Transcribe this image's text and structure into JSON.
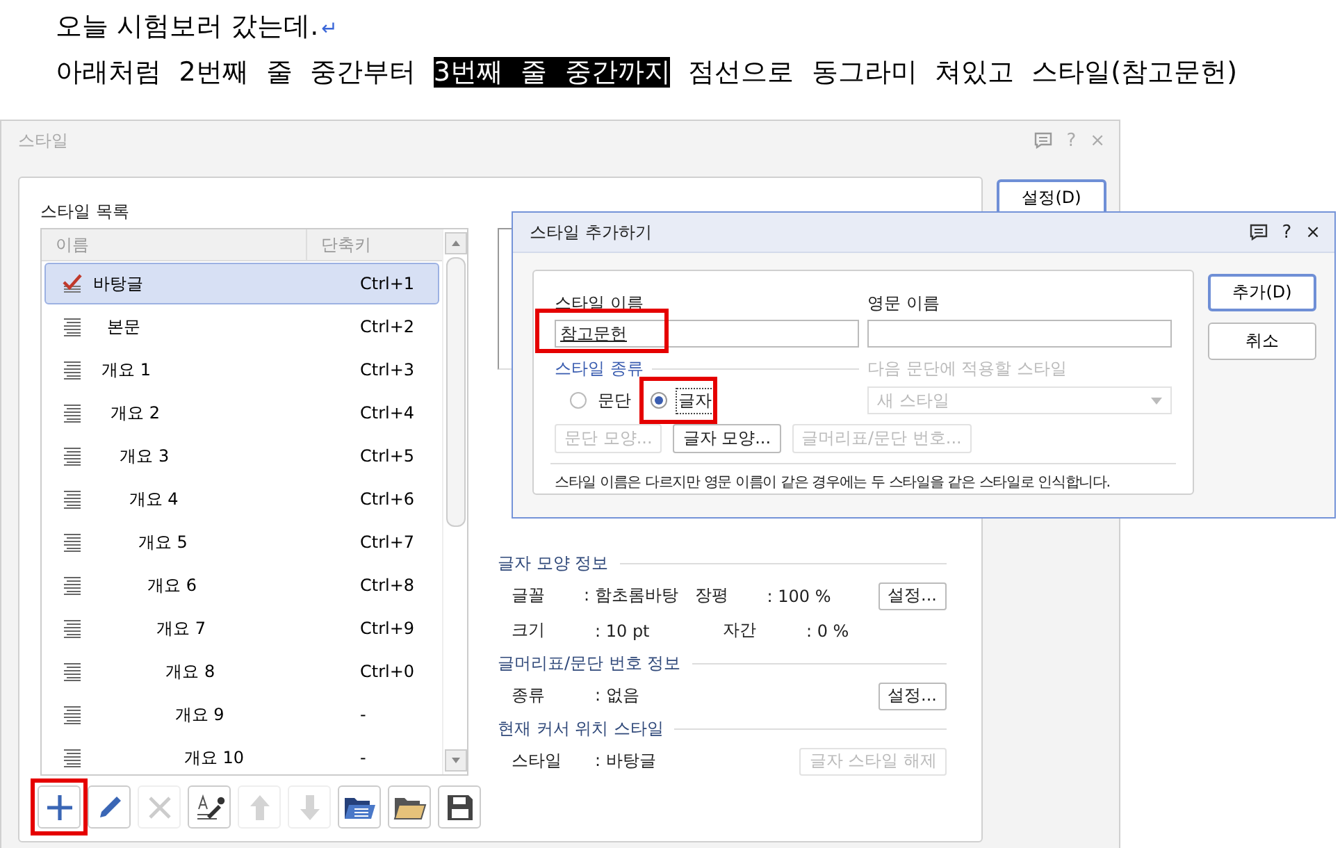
{
  "document": {
    "lines": [
      {
        "segments": [
          {
            "text": "오늘 시험보러 갔는데.",
            "selected": false
          }
        ],
        "end_mark": "↵",
        "justify": false
      },
      {
        "segments": [
          {
            "text": "아래처럼 2번째 줄 중간부터 ",
            "selected": false
          },
          {
            "text": "3번째 줄 중간까지",
            "selected": true
          },
          {
            "text": " 점선으로 동그라미 쳐있고 스타일(참고문헌)",
            "selected": false
          }
        ],
        "justify": true
      }
    ]
  },
  "style_dialog": {
    "title": "스타일",
    "help": "?",
    "close": "×",
    "list_label": "스타일 목록",
    "columns": [
      "이름",
      "단축키"
    ],
    "rows": [
      {
        "name": "바탕글",
        "shortcut": "Ctrl+1",
        "kind": "checked",
        "selected": true
      },
      {
        "name": "본문",
        "shortcut": "Ctrl+2",
        "kind": "paragraph",
        "selected": false
      },
      {
        "name": "개요 1",
        "shortcut": "Ctrl+3",
        "kind": "paragraph",
        "selected": false
      },
      {
        "name": "개요 2",
        "shortcut": "Ctrl+4",
        "kind": "paragraph",
        "selected": false
      },
      {
        "name": "개요 3",
        "shortcut": "Ctrl+5",
        "kind": "paragraph",
        "selected": false
      },
      {
        "name": "개요 4",
        "shortcut": "Ctrl+6",
        "kind": "paragraph",
        "selected": false
      },
      {
        "name": "개요 5",
        "shortcut": "Ctrl+7",
        "kind": "paragraph",
        "selected": false
      },
      {
        "name": "개요 6",
        "shortcut": "Ctrl+8",
        "kind": "paragraph",
        "selected": false
      },
      {
        "name": "개요 7",
        "shortcut": "Ctrl+9",
        "kind": "paragraph",
        "selected": false
      },
      {
        "name": "개요 8",
        "shortcut": "Ctrl+0",
        "kind": "paragraph",
        "selected": false
      },
      {
        "name": "개요 9",
        "shortcut": "-",
        "kind": "paragraph",
        "selected": false
      },
      {
        "name": "개요 10",
        "shortcut": "-",
        "kind": "paragraph",
        "selected": false
      }
    ],
    "toolbar": [
      {
        "kind": "add",
        "disabled": false,
        "highlighted": true
      },
      {
        "kind": "edit",
        "disabled": false,
        "highlighted": false
      },
      {
        "kind": "delete",
        "disabled": true,
        "highlighted": false
      },
      {
        "kind": "eyedropper",
        "disabled": false,
        "highlighted": false
      },
      {
        "kind": "up",
        "disabled": true,
        "highlighted": false
      },
      {
        "kind": "down",
        "disabled": true,
        "highlighted": false
      },
      {
        "kind": "import",
        "disabled": false,
        "highlighted": false
      },
      {
        "kind": "open",
        "disabled": false,
        "highlighted": false
      },
      {
        "kind": "save",
        "disabled": false,
        "highlighted": false
      }
    ],
    "setup_button": "설정(D)",
    "sections": [
      {
        "title": "글자 모양 정보",
        "rows": [
          {
            "cells": [
              {
                "label": "글꼴",
                "value": ": 함초롬바탕"
              },
              {
                "label": "장평",
                "value": ": 100 %"
              }
            ],
            "button": {
              "label": "설정...",
              "disabled": false
            }
          },
          {
            "cells": [
              {
                "label": "크기",
                "value": ": 10 pt"
              },
              {
                "label": "자간",
                "value": ": 0 %"
              }
            ]
          }
        ]
      },
      {
        "title": "글머리표/문단 번호 정보",
        "rows": [
          {
            "cells": [
              {
                "label": "종류",
                "value": ": 없음"
              }
            ],
            "button": {
              "label": "설정...",
              "disabled": false
            }
          }
        ]
      },
      {
        "title": "현재 커서 위치 스타일",
        "rows": [
          {
            "cells": [
              {
                "label": "스타일",
                "value": ": 바탕글"
              }
            ],
            "button": {
              "label": "글자 스타일 해제",
              "disabled": true
            }
          }
        ]
      }
    ]
  },
  "add_dialog": {
    "title": "스타일 추가하기",
    "help": "?",
    "close": "×",
    "name_label": "스타일 이름",
    "name_field": {
      "value": "참고문헌",
      "highlighted": true
    },
    "english_label": "영문 이름",
    "type_label": "스타일 종류",
    "radios": [
      {
        "label": "문단",
        "selected": false,
        "highlighted": false
      },
      {
        "label": "글자",
        "selected": true,
        "highlighted": true
      }
    ],
    "next_label": "다음 문단에 적용할 스타일",
    "next_dropdown": {
      "value": "새 스타일",
      "disabled": true
    },
    "buttons": [
      {
        "label": "문단 모양...",
        "disabled": true
      },
      {
        "label": "글자 모양...",
        "disabled": false
      },
      {
        "label": "글머리표/문단 번호...",
        "disabled": true
      }
    ],
    "message": "스타일 이름은 다르지만 영문 이름이 같은 경우에는 두 스타일을 같은 스타일로 인식합니다.",
    "actions": [
      {
        "label": "추가(D)",
        "kind": "primary"
      },
      {
        "label": "취소",
        "kind": "normal"
      }
    ]
  }
}
